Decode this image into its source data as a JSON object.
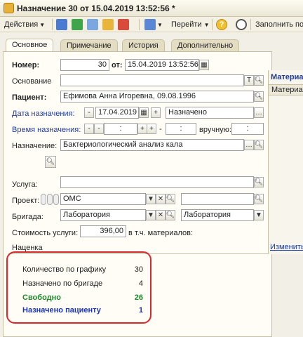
{
  "window": {
    "title": "Назначение 30 от 15.04.2019 13:52:56 *"
  },
  "toolbar": {
    "actions_label": "Действия",
    "goto_label": "Перейти",
    "fill_label": "Заполнить по"
  },
  "tabs": [
    "Основное",
    "Примечание",
    "История",
    "Дополнительно"
  ],
  "form": {
    "number_label": "Номер:",
    "number_value": "30",
    "from_label": "от:",
    "datetime_value": "15.04.2019 13:52:56",
    "basis_label": "Основание",
    "basis_value": "",
    "patient_label": "Пациент:",
    "patient_value": "Ефимова Анна Игоревна, 09.08.1996",
    "appoint_date_label": "Дата назначения:",
    "appoint_date_value": "17.04.2019",
    "status_value": "Назначено",
    "appoint_time_label": "Время назначения:",
    "time_value_1": ":",
    "time_value_2": ":",
    "manual_label": "вручную:",
    "manual_value": ":",
    "assignment_label": "Назначение:",
    "assignment_value": "Бактериологический анализ кала",
    "service_label": "Услуга:",
    "service_value": "",
    "project_label": "Проект:",
    "project_value": "ОМС",
    "brigade_label": "Бригада:",
    "brigade_value": "Лаборатория",
    "brigade_value_2": "Лаборатория",
    "cost_label": "Стоимость услуги:",
    "cost_value": "396,00",
    "materials_label": "в т.ч. материалов:",
    "markup_label": "Наценка"
  },
  "right_panel": {
    "title": "Материа",
    "tab": "Материа",
    "change_link": "Изменить"
  },
  "stats": {
    "by_schedule_label": "Количество по графику",
    "by_schedule_value": "30",
    "by_brigade_label": "Назначено по бригаде",
    "by_brigade_value": "4",
    "free_label": "Свободно",
    "free_value": "26",
    "patient_label": "Назначено пациенту",
    "patient_value": "1"
  },
  "colors": {
    "highlight": "#d8282a",
    "green": "#1a8a2a",
    "navy": "#1a34b8"
  }
}
